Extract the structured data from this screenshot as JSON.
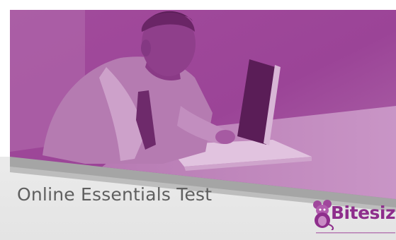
{
  "slide": {
    "title": "Online Essentials Test"
  },
  "logo": {
    "wordmark": "Bitesize",
    "icon": "mouse-mascot-icon"
  },
  "colors": {
    "brand_purple": "#8e2e8c",
    "photo_tint": "#9b4596",
    "band_grey": "#a7a7a7",
    "background_grey": "#ececec",
    "title_text": "#5f5f5f"
  }
}
